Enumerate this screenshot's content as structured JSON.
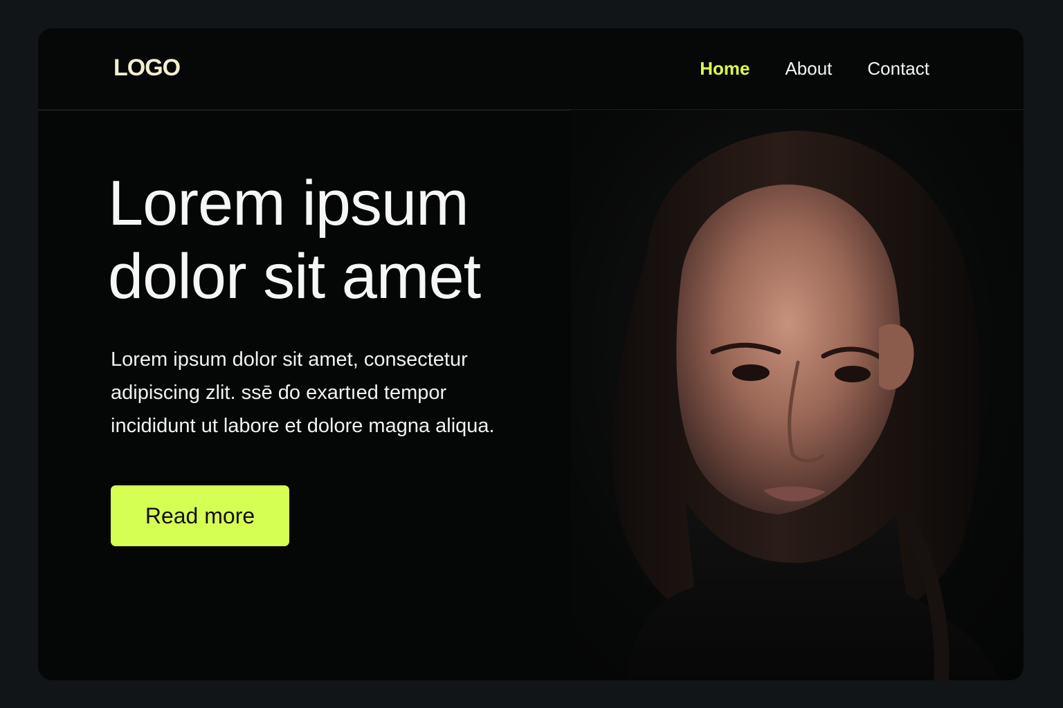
{
  "logo": {
    "text": "LOGO"
  },
  "nav": {
    "items": [
      {
        "label": "Home",
        "active": true
      },
      {
        "label": "About",
        "active": false
      },
      {
        "label": "Contact",
        "active": false
      }
    ]
  },
  "hero": {
    "title_line1": "Lorem ipsum",
    "title_line2": "dolor sit amet",
    "body_line1": "Lorem ipsum dolor sit amet, consectetur",
    "body_line2": "adipiscing zlit. ssē ɗo exartıed tempor",
    "body_line3": "incididunt ut labore et dolore magna aliqua.",
    "button_label": "Read more"
  },
  "image": {
    "subject": "portrait-photo"
  },
  "colors": {
    "accent": "#d6ff54",
    "background": "#050707",
    "outer_background": "#121517",
    "text": "#f4f4f4"
  }
}
